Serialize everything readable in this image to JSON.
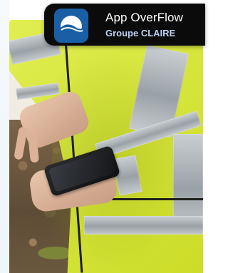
{
  "badge": {
    "app_name": "App OverFlow",
    "publisher": "Groupe CLAIRE",
    "icon": "app-overflow-logo-icon",
    "colors": {
      "badge_background": "#0b0b0c",
      "icon_background": "#1a5ea6",
      "title_text": "#ffffff",
      "subtitle_text": "#b9d2f2"
    }
  },
  "photo": {
    "subject": "photo-person-in-hi-vis-jacket-with-phone"
  }
}
